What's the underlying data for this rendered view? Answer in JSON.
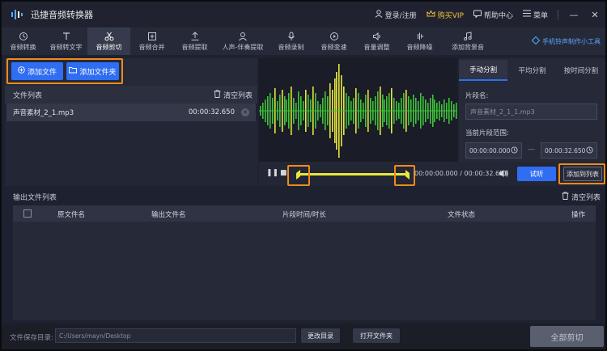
{
  "app": {
    "title": "迅捷音频转换器"
  },
  "titlebar": {
    "login": "登录/注册",
    "vip": "购买VIP",
    "help": "帮助中心",
    "menu": "菜单",
    "minimize": "—",
    "close": "✕"
  },
  "toolbar": {
    "items": [
      {
        "label": "音频转换",
        "icon": "refresh-icon"
      },
      {
        "label": "音频转文字",
        "icon": "text-icon"
      },
      {
        "label": "音频剪切",
        "icon": "scissors-icon"
      },
      {
        "label": "音频合并",
        "icon": "merge-icon"
      },
      {
        "label": "音频提取",
        "icon": "extract-icon"
      },
      {
        "label": "人声-伴奏提取",
        "icon": "vocal-icon"
      },
      {
        "label": "音频录制",
        "icon": "mic-icon"
      },
      {
        "label": "音频变速",
        "icon": "speed-icon"
      },
      {
        "label": "音量调整",
        "icon": "volume-icon"
      },
      {
        "label": "音频降噪",
        "icon": "denoise-icon"
      },
      {
        "label": "添加背景音",
        "icon": "bgmusic-icon"
      }
    ],
    "mobile_link": "手机铃声制作小工具"
  },
  "left": {
    "add_file": "添加文件",
    "add_folder": "添加文件夹",
    "file_list_title": "文件列表",
    "clear_list": "清空列表",
    "files": [
      {
        "name": "声音素材_2_1.mp3",
        "duration": "00:00:32.650"
      }
    ]
  },
  "player": {
    "current_time": "00:00:00.000",
    "total_time": "00:00:32.653",
    "time_sep": " / ",
    "pause": "❚❚",
    "stop": "■",
    "try_listen": "试听",
    "add_to_list": "添加到列表"
  },
  "right": {
    "tabs": [
      "手动分割",
      "平均分割",
      "按时间分割"
    ],
    "segment_name_label": "片段名:",
    "segment_name_placeholder": "声音素材_2_1_1.mp3",
    "range_label": "当前片段范围:",
    "start_time": "00:00:00.000",
    "end_time": "00:00:32.650",
    "range_sep": "—"
  },
  "output": {
    "title": "输出文件列表",
    "clear_list": "清空列表",
    "columns": [
      "原文件名",
      "输出文件名",
      "片段时间/时长",
      "文件状态",
      "操作"
    ]
  },
  "bottom": {
    "save_label": "文件保存目录:",
    "save_path": "C:/Users/mayn/Desktop",
    "change_dir": "更改目录",
    "open_folder": "打开文件夹",
    "cut_all": "全部剪切"
  },
  "colors": {
    "accent": "#2f6ef2",
    "highlight": "#f08a1c",
    "vip": "#f3c13a",
    "wave_green": "#3ec43a",
    "wave_yellow": "#e6e83c"
  }
}
